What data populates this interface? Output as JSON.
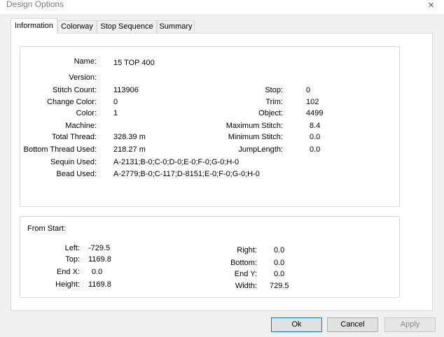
{
  "window": {
    "title": "Design Options",
    "close_glyph": "×"
  },
  "tabs": [
    "Information",
    "Colorway",
    "Stop Sequence",
    "Summary"
  ],
  "info": {
    "name_label": "Name:",
    "name_value": "15 TOP 400",
    "version_label": "Version:",
    "version_value": "",
    "stitch_count_label": "Stitch Count:",
    "stitch_count_value": "113906",
    "change_color_label": "Change Color:",
    "change_color_value": "0",
    "color_label": "Color:",
    "color_value": "1",
    "machine_label": "Machine:",
    "machine_value": "",
    "total_thread_label": "Total Thread:",
    "total_thread_value": "328.39 m",
    "bottom_thread_label": "Bottom Thread Used:",
    "bottom_thread_value": "218.27 m",
    "sequin_label": "Sequin Used:",
    "sequin_value": "A-2131;B-0;C-0;D-0;E-0;F-0;G-0;H-0",
    "bead_label": "Bead Used:",
    "bead_value": "A-2779;B-0;C-117;D-8151;E-0;F-0;G-0;H-0",
    "stop_label": "Stop:",
    "stop_value": "0",
    "trim_label": "Trim:",
    "trim_value": "102",
    "object_label": "Object:",
    "object_value": "4499",
    "max_stitch_label": "Maximum Stitch:",
    "max_stitch_value": "8.4",
    "min_stitch_label": "Minimum Stitch:",
    "min_stitch_value": "0.0",
    "jump_length_label": "JumpLength:",
    "jump_length_value": "0.0"
  },
  "from_start": {
    "heading": "From Start:",
    "left_label": "Left:",
    "left_value": "-729.5",
    "top_label": "Top:",
    "top_value": "1169.8",
    "endx_label": "End X:",
    "endx_value": "0.0",
    "height_label": "Height:",
    "height_value": "1169.8",
    "right_label": "Right:",
    "right_value": "0.0",
    "bottom_label": "Bottom:",
    "bottom_value": "0.0",
    "endy_label": "End Y:",
    "endy_value": "0.0",
    "width_label": "Width:",
    "width_value": "729.5"
  },
  "buttons": {
    "ok": "Ok",
    "cancel": "Cancel",
    "apply": "Apply"
  }
}
